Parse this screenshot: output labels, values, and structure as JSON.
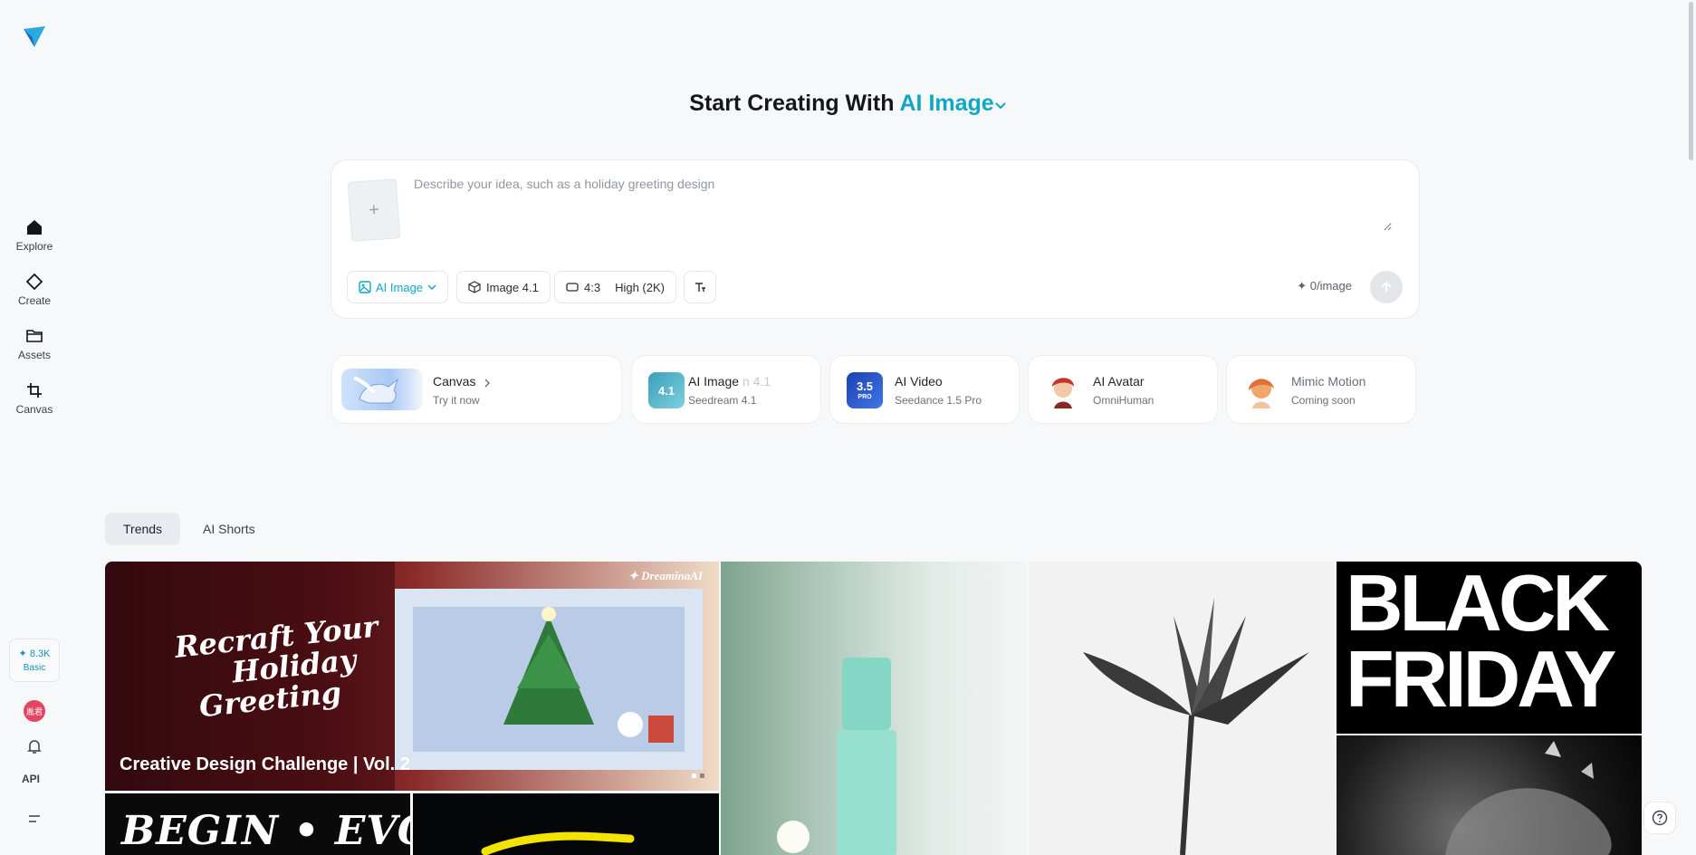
{
  "sidebar": {
    "nav": [
      {
        "label": "Explore",
        "icon": "home-icon"
      },
      {
        "label": "Create",
        "icon": "diamond-icon"
      },
      {
        "label": "Assets",
        "icon": "folder-icon"
      },
      {
        "label": "Canvas",
        "icon": "crop-icon"
      }
    ],
    "credits": {
      "amount": "✦ 8.3K",
      "plan": "Basic"
    },
    "avatar_text": "胤君",
    "api_label": "API"
  },
  "headline": {
    "prefix": "Start Creating With",
    "mode": "AI Image"
  },
  "prompt": {
    "placeholder": "Describe your idea, such as a holiday greeting design",
    "value": "",
    "add_symbol": "+",
    "chips": {
      "mode": "AI Image",
      "model": "Image 4.1",
      "ratio": "4:3",
      "quality": "High (2K)"
    },
    "cost": "✦ 0/image"
  },
  "feature_cards": [
    {
      "title": "Canvas",
      "sub": "Try it now"
    },
    {
      "title": "AI Image",
      "sub": "Seedream 4.1",
      "overlay_text": "n 4.1",
      "thumb_text": "4.1"
    },
    {
      "title": "AI Video",
      "sub": "Seedance 1.5 Pro",
      "thumb_text": "3.5",
      "thumb_badge": "PRO"
    },
    {
      "title": "AI Avatar",
      "sub": "OmniHuman"
    },
    {
      "title": "Mimic Motion",
      "sub": "Coming soon"
    }
  ],
  "tabs": [
    "Trends",
    "AI Shorts"
  ],
  "feed": {
    "banner": {
      "brand": "✦ DreaminaAI",
      "script_lines": [
        "Recraft Your",
        "Holiday",
        "Greeting"
      ],
      "caption": "Creative Design Challenge | Vol. 2"
    },
    "black_friday_lines": [
      "BLACK",
      "FRIDAY"
    ],
    "begin_evolve": "BEGIN • EVOLVE •"
  },
  "colors": {
    "accent": "#10a6c6",
    "avatar": "#e54561",
    "background": "#f6f8fa"
  }
}
